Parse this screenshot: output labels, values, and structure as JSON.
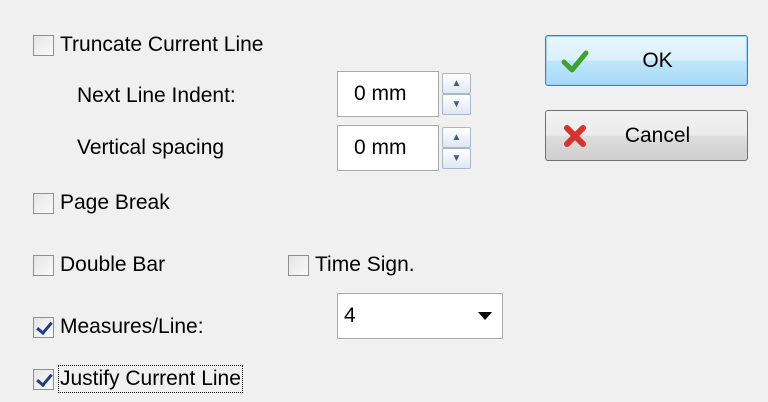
{
  "options": {
    "truncate_current_line": {
      "label": "Truncate Current Line",
      "checked": false
    },
    "page_break": {
      "label": "Page Break",
      "checked": false
    },
    "double_bar": {
      "label": "Double Bar",
      "checked": false
    },
    "time_sign": {
      "label": "Time Sign.",
      "checked": false
    },
    "measures_per_line": {
      "label": "Measures/Line:",
      "checked": true
    },
    "justify_current_line": {
      "label": "Justify Current Line",
      "checked": true
    }
  },
  "next_line_indent": {
    "label": "Next Line Indent:",
    "value": "0 mm"
  },
  "vertical_spacing": {
    "label": "Vertical spacing",
    "value": "0 mm"
  },
  "measures_select": {
    "selected": "4"
  },
  "buttons": {
    "ok_label": "OK",
    "cancel_label": "Cancel"
  },
  "colors": {
    "ok_icon": "#3aa52a",
    "cancel_icon": "#d9312b",
    "default_button_border": "#3c7fb1"
  },
  "icons": {
    "ok": "checkmark-icon",
    "cancel": "red-x-icon",
    "spin_up": "triangle-up-icon",
    "spin_down": "triangle-down-icon",
    "dropdown": "chevron-down-icon"
  }
}
